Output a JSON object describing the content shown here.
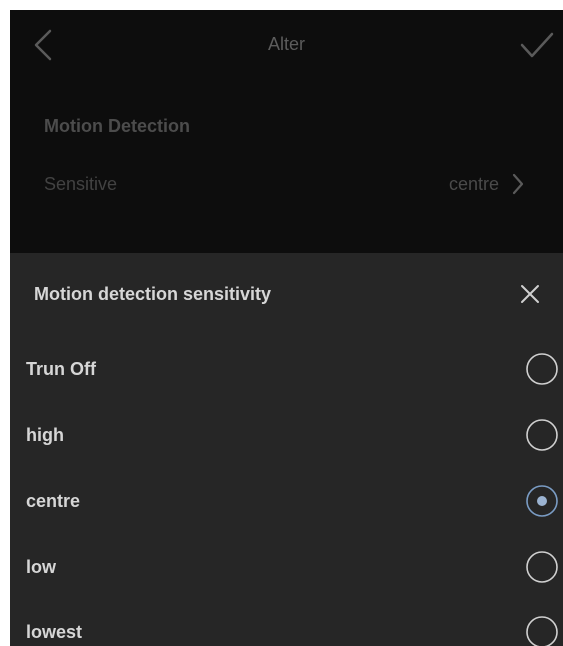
{
  "background": {
    "nav": {
      "title": "Alter",
      "back_icon": "chevron-left-icon",
      "confirm_icon": "check-icon"
    },
    "section_title": "Motion Detection",
    "setting": {
      "label": "Sensitive",
      "value": "centre",
      "chevron_icon": "chevron-right-icon"
    }
  },
  "sheet": {
    "title": "Motion detection sensitivity",
    "close_icon": "close-icon",
    "options": [
      {
        "label": "Trun Off",
        "selected": false
      },
      {
        "label": "high",
        "selected": false
      },
      {
        "label": "centre",
        "selected": true
      },
      {
        "label": "low",
        "selected": false
      },
      {
        "label": "lowest",
        "selected": false
      }
    ]
  },
  "colors": {
    "backdrop": "#0d0d0d",
    "sheet": "#262626",
    "text": "#d6d6d6",
    "accent": "#7a9cc4"
  }
}
